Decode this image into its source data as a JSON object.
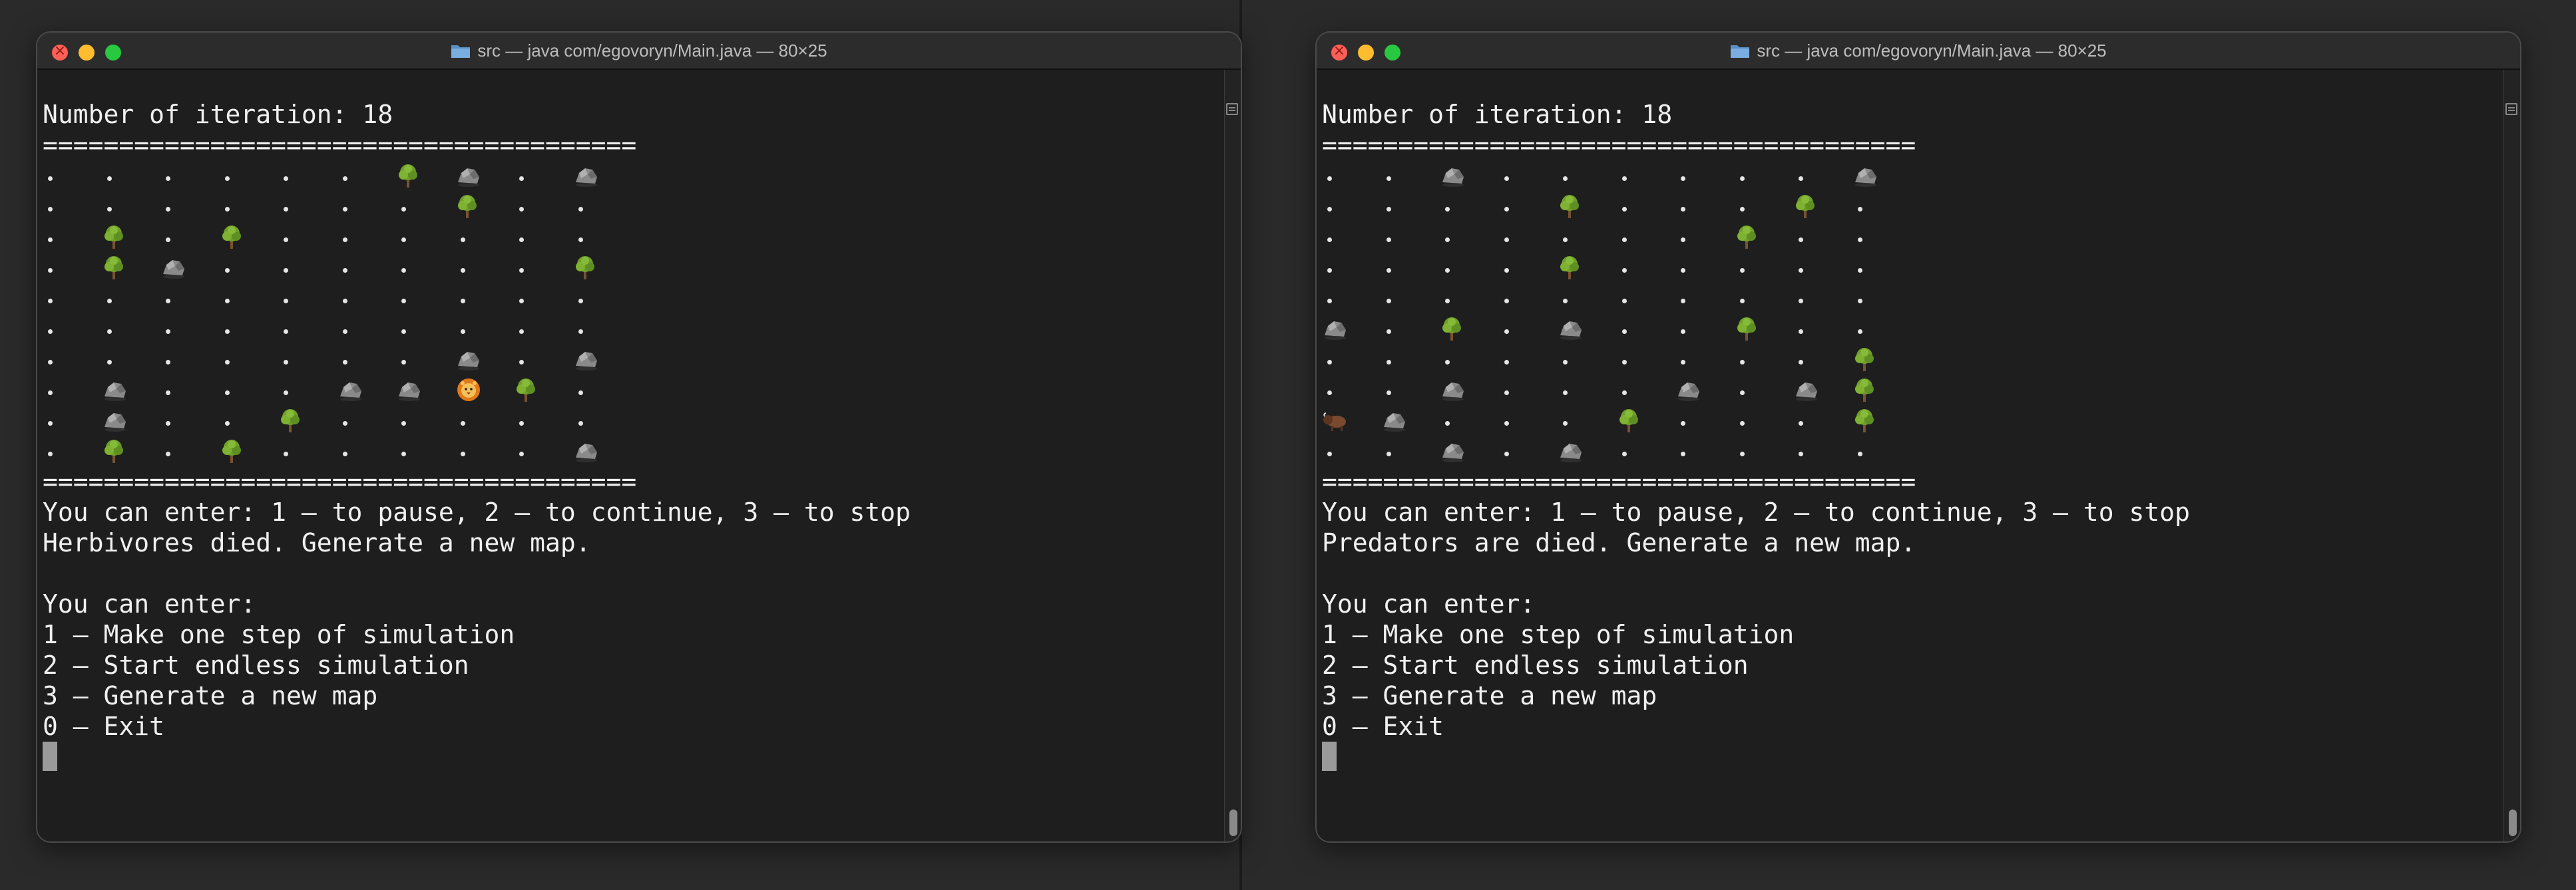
{
  "windows": [
    {
      "title": "src — java com/egovoryn/Main.java — 80×25",
      "header": "Number of iteration: 18",
      "separator": "=======================================",
      "grid": [
        ". . . . . . T R . R",
        ". . . . . . . T . .",
        ". T . T . . . . . .",
        ". T R . . . . . . T",
        ". . . . . . . . . .",
        ". . . . . . . . . .",
        ". . . . . . . R . R",
        ". R . . . R R L T .",
        ". R . . T . . . . .",
        ". T . T . . . . . R"
      ],
      "prompt": "You can enter: 1 — to pause, 2 — to continue, 3 — to stop",
      "status": "Herbivores died. Generate a new map.",
      "blank": "",
      "menu_header": "You can enter:",
      "menu": [
        "1 — Make one step of simulation",
        "2 — Start endless simulation",
        "3 — Generate a new map",
        "0 — Exit"
      ]
    },
    {
      "title": "src — java com/egovoryn/Main.java — 80×25",
      "header": "Number of iteration: 18",
      "separator": "=======================================",
      "grid": [
        ". . R . . . . . . R",
        ". . . . T . . . T .",
        ". . . . . . . T . .",
        ". . . . T . . . . .",
        ". . . . . . . . . .",
        "R . T . R . . T . .",
        ". . . . . . . . . T",
        ". . R . . . R . R T",
        "B R . . . T . . . T",
        ". . R . R . . . . ."
      ],
      "prompt": "You can enter: 1 — to pause, 2 — to continue, 3 — to stop",
      "status": "Predators are died. Generate a new map.",
      "blank": "",
      "menu_header": "You can enter:",
      "menu": [
        "1 — Make one step of simulation",
        "2 — Start endless simulation",
        "3 — Generate a new map",
        "0 — Exit"
      ]
    }
  ],
  "legend": {
    ".": "empty-cell",
    "T": "tree-icon",
    "R": "rock-icon",
    "L": "lion-icon",
    "B": "bison-icon"
  },
  "colors": {
    "terminal_bg": "#1e1e1e",
    "text": "#f0f0f0",
    "tree": "#6f9f2a",
    "rock": "#8a8a8a",
    "lion": "#f3a024",
    "bison": "#7a4a30"
  }
}
